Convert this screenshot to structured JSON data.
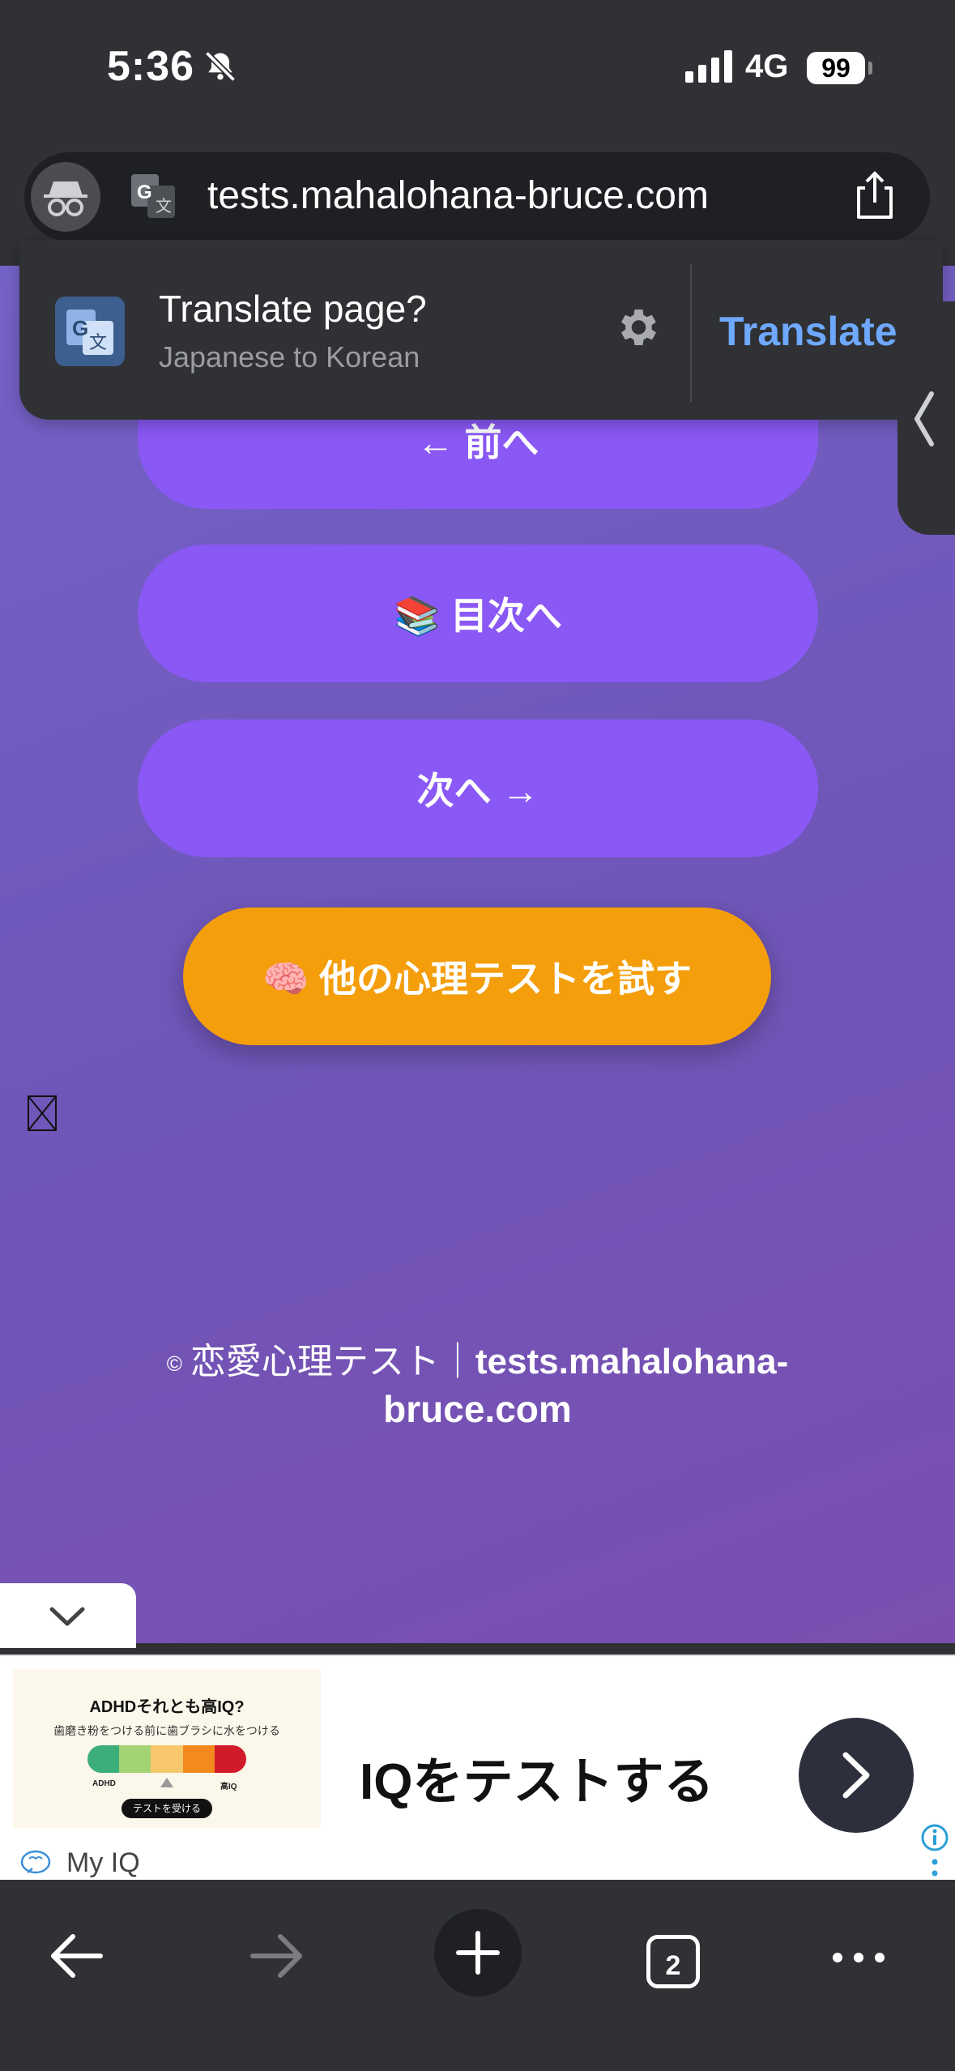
{
  "status_bar": {
    "time": "5:36",
    "network": "4G",
    "battery": "99"
  },
  "browser": {
    "url": "tests.mahalohana-bruce.com",
    "open_tabs": "2"
  },
  "translate_banner": {
    "title": "Translate page?",
    "subtitle": "Japanese to Korean",
    "action": "Translate"
  },
  "page": {
    "prev_button": "← 前へ",
    "toc_button": "📚 目次へ",
    "next_button": "次へ →",
    "other_tests_button": "🧠 他の心理テストを試す",
    "footer_copyright": "©",
    "footer_site_name": "恋愛心理テスト｜",
    "footer_domain_part1": "tests.mahalohana-",
    "footer_domain_part2": "bruce.com"
  },
  "ad": {
    "image_title": "ADHDそれとも高IQ?",
    "image_subtitle": "歯磨き粉をつける前に歯ブラシに水をつける",
    "image_scale_low": "ADHD",
    "image_scale_high": "高IQ",
    "image_button": "テストを受ける",
    "scale_colors": [
      "#3cae7a",
      "#a4d374",
      "#f7c86b",
      "#f48a1c",
      "#d11a2a"
    ],
    "headline": "IQをテストする",
    "brand": "My IQ"
  },
  "colors": {
    "page_gradient_start": "#7562c8",
    "button_purple": "#8a58f5",
    "button_orange": "#f49e0c",
    "translate_blue": "#6ea8ff",
    "chrome_dark": "#2f3134"
  }
}
